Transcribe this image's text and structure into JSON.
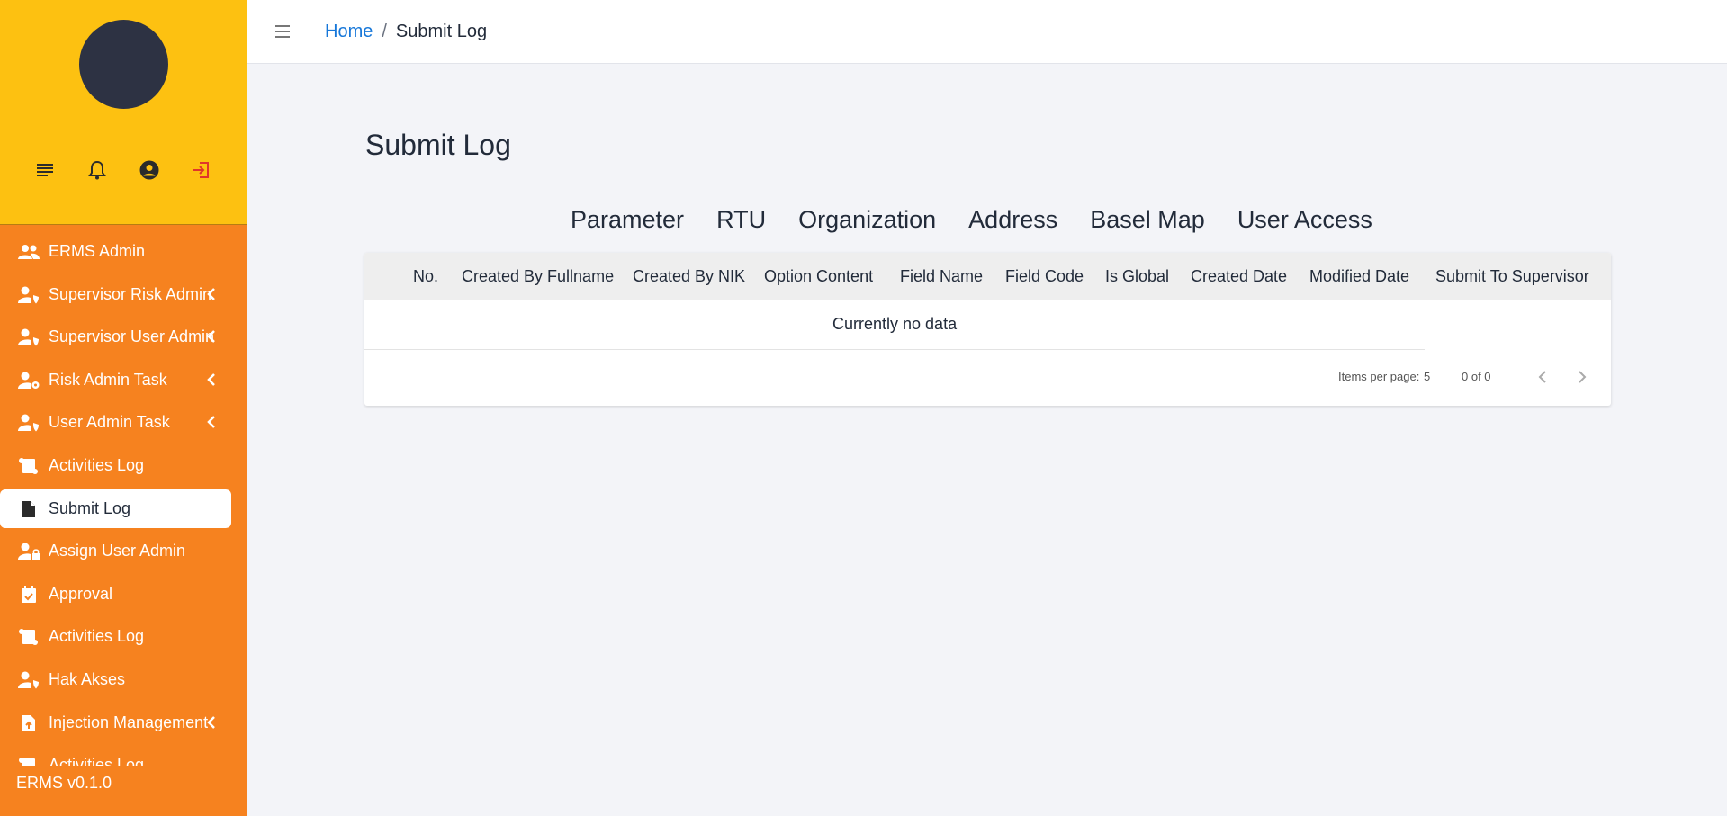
{
  "sidebar": {
    "top_icons": [
      {
        "name": "notes-icon"
      },
      {
        "name": "bell-icon"
      },
      {
        "name": "user-circle-icon"
      },
      {
        "name": "logout-icon"
      }
    ],
    "items": [
      {
        "label": "ERMS Admin",
        "icon": "users-icon",
        "has_chevron": false
      },
      {
        "label": "Supervisor Risk Admin",
        "icon": "user-shield-icon",
        "has_chevron": true
      },
      {
        "label": "Supervisor User Admin",
        "icon": "user-shield-icon",
        "has_chevron": true
      },
      {
        "label": "Risk Admin Task",
        "icon": "user-gear-icon",
        "has_chevron": true
      },
      {
        "label": "User Admin Task",
        "icon": "user-shield-icon",
        "has_chevron": true
      },
      {
        "label": "Activities Log",
        "icon": "scroll-icon",
        "has_chevron": false
      },
      {
        "label": "Submit Log",
        "icon": "file-icon",
        "has_chevron": false,
        "active": true
      },
      {
        "label": "Assign User Admin",
        "icon": "user-lock-icon",
        "has_chevron": false
      },
      {
        "label": "Approval",
        "icon": "calendar-check-icon",
        "has_chevron": false
      },
      {
        "label": "Activities Log",
        "icon": "scroll-icon",
        "has_chevron": false
      },
      {
        "label": "Hak Akses",
        "icon": "user-shield-icon",
        "has_chevron": false
      },
      {
        "label": "Injection Management",
        "icon": "file-upload-icon",
        "has_chevron": true
      },
      {
        "label": "Activities Log",
        "icon": "scroll-icon",
        "has_chevron": false
      }
    ],
    "version": "ERMS v0.1.0"
  },
  "header": {
    "breadcrumb": {
      "home": "Home",
      "separator": "/",
      "current": "Submit Log"
    }
  },
  "main": {
    "title": "Submit Log",
    "tabs": [
      "Parameter",
      "RTU",
      "Organization",
      "Address",
      "Basel Map",
      "User Access"
    ],
    "table": {
      "columns": [
        "No.",
        "Created By Fullname",
        "Created By NIK",
        "Option Content",
        "Field Name",
        "Field Code",
        "Is Global",
        "Created Date",
        "Modified Date",
        "Submit To Supervisor"
      ],
      "empty_text": "Currently no data",
      "paginator": {
        "items_per_page_label": "Items per page:",
        "items_per_page": "5",
        "range": "0 of 0"
      }
    }
  },
  "colors": {
    "sidebar_top": "#fdc111",
    "sidebar": "#f6821f",
    "link": "#1677d9",
    "logout": "#e0352b"
  }
}
